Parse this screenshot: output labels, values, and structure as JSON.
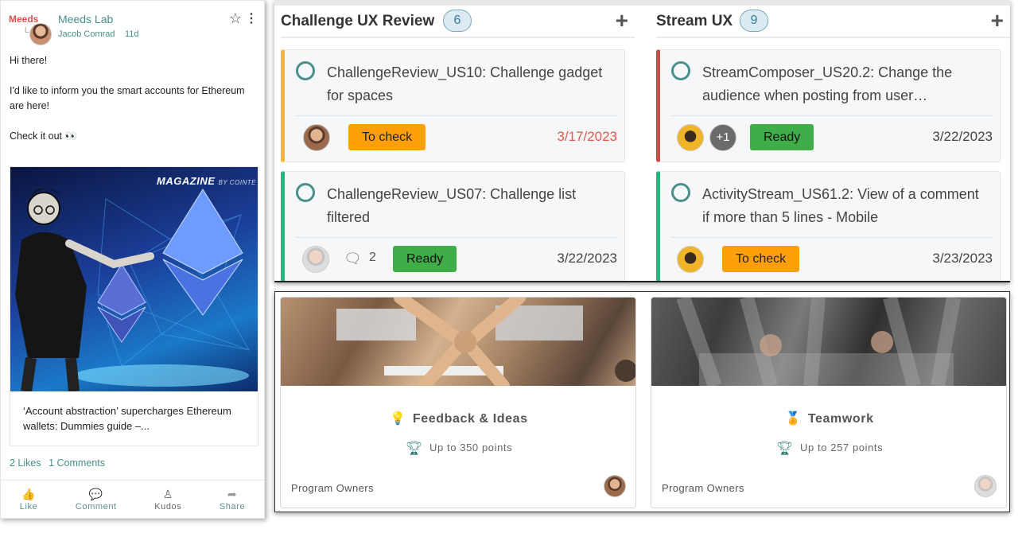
{
  "post": {
    "space_logo": "Meeds",
    "space_logo_sub": "L",
    "space_name": "Meeds Lab",
    "author": "Jacob Comrad",
    "time": "11d",
    "body": [
      "Hi there!",
      "I'd like to inform you the smart accounts for Ethereum are here!",
      "Check it out 👀"
    ],
    "preview": {
      "magazine": "MAGAZINE",
      "magazine_by": "BY COINTE",
      "title": "‘Account abstraction’ supercharges Ethereum wallets: Dummies guide –..."
    },
    "stats": {
      "likes": "2 Likes",
      "comments": "1 Comments"
    },
    "actions": [
      {
        "icon": "thumb-up-icon",
        "label": "Like"
      },
      {
        "icon": "comment-icon",
        "label": "Comment"
      },
      {
        "icon": "kudos-icon",
        "label": "Kudos"
      },
      {
        "icon": "share-icon",
        "label": "Share"
      }
    ]
  },
  "board": {
    "columns": [
      {
        "title": "Challenge UX Review",
        "count": "6",
        "cards": [
          {
            "title": "ChallengeReview_US10: Challenge gadget for spaces",
            "status": "To check",
            "due": "3/17/2023",
            "accent": "#f5b82e"
          },
          {
            "title": "ChallengeReview_US07: Challenge list filtered",
            "comments": "2",
            "status": "Ready",
            "due": "3/22/2023",
            "accent": "#2bb37f"
          }
        ]
      },
      {
        "title": "Stream UX",
        "count": "9",
        "cards": [
          {
            "title": "StreamComposer_US20.2: Change the audience when posting from user…",
            "extra_assignees": "+1",
            "status": "Ready",
            "due": "3/22/2023",
            "accent": "#d04848"
          },
          {
            "title": "ActivityStream_US61.2: View of a comment if more than 5 lines - Mobile",
            "status": "To check",
            "due": "3/23/2023",
            "accent": "#2bb37f"
          }
        ]
      }
    ]
  },
  "programs": [
    {
      "emoji": "💡",
      "title": "Feedback & Ideas",
      "points": "Up to 350 points",
      "owners_label": "Program Owners"
    },
    {
      "emoji": "🏅",
      "title": "Teamwork",
      "points": "Up to 257 points",
      "owners_label": "Program Owners"
    }
  ],
  "colors": {
    "accent_teal": "#4a8f8a",
    "status_ready": "#3fae49",
    "status_check": "#ff9f0a",
    "late_due": "#e8584a"
  }
}
